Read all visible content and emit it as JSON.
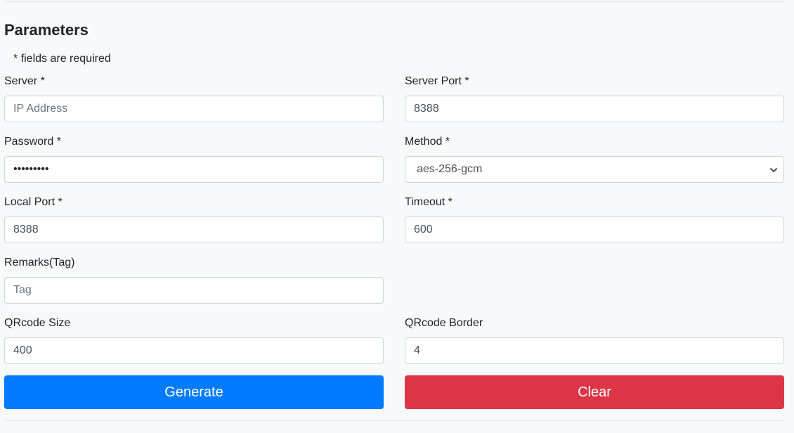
{
  "section": {
    "title": "Parameters",
    "required_note": "* fields are required"
  },
  "fields": {
    "server": {
      "label": "Server *",
      "placeholder": "IP Address",
      "value": ""
    },
    "server_port": {
      "label": "Server Port *",
      "value": "8388"
    },
    "password": {
      "label": "Password *",
      "value": "•••••••••"
    },
    "method": {
      "label": "Method *",
      "value": "aes-256-gcm"
    },
    "local_port": {
      "label": "Local Port *",
      "value": "8388"
    },
    "timeout": {
      "label": "Timeout *",
      "value": "600"
    },
    "remarks": {
      "label": "Remarks(Tag)",
      "placeholder": "Tag",
      "value": ""
    },
    "qrcode_size": {
      "label": "QRcode Size",
      "value": "400"
    },
    "qrcode_border": {
      "label": "QRcode Border",
      "value": "4"
    }
  },
  "buttons": {
    "generate": "Generate",
    "clear": "Clear"
  },
  "colors": {
    "primary": "#007bff",
    "danger": "#dc3545",
    "background": "#f8f9fa",
    "border": "#ced4da"
  }
}
